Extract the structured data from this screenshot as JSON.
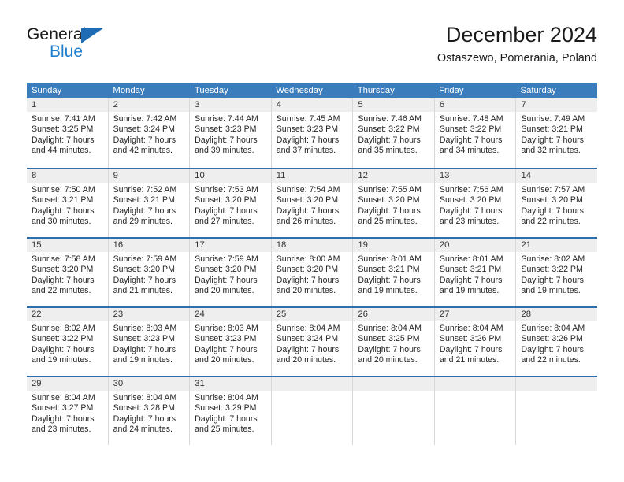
{
  "brand": {
    "name_top": "General",
    "name_bottom": "Blue",
    "triangle_color": "#1f6cb4",
    "bottom_color": "#1f7fd0"
  },
  "header": {
    "title": "December 2024",
    "subtitle": "Ostaszewo, Pomerania, Poland"
  },
  "colors": {
    "header_bar": "#3b7cbd",
    "week_divider": "#2f6fae",
    "day_band": "#eeeeee",
    "cell_border": "#d8d8d8"
  },
  "weekdays": [
    "Sunday",
    "Monday",
    "Tuesday",
    "Wednesday",
    "Thursday",
    "Friday",
    "Saturday"
  ],
  "weeks": [
    [
      {
        "day": "1",
        "sunrise": "Sunrise: 7:41 AM",
        "sunset": "Sunset: 3:25 PM",
        "daylight1": "Daylight: 7 hours",
        "daylight2": "and 44 minutes."
      },
      {
        "day": "2",
        "sunrise": "Sunrise: 7:42 AM",
        "sunset": "Sunset: 3:24 PM",
        "daylight1": "Daylight: 7 hours",
        "daylight2": "and 42 minutes."
      },
      {
        "day": "3",
        "sunrise": "Sunrise: 7:44 AM",
        "sunset": "Sunset: 3:23 PM",
        "daylight1": "Daylight: 7 hours",
        "daylight2": "and 39 minutes."
      },
      {
        "day": "4",
        "sunrise": "Sunrise: 7:45 AM",
        "sunset": "Sunset: 3:23 PM",
        "daylight1": "Daylight: 7 hours",
        "daylight2": "and 37 minutes."
      },
      {
        "day": "5",
        "sunrise": "Sunrise: 7:46 AM",
        "sunset": "Sunset: 3:22 PM",
        "daylight1": "Daylight: 7 hours",
        "daylight2": "and 35 minutes."
      },
      {
        "day": "6",
        "sunrise": "Sunrise: 7:48 AM",
        "sunset": "Sunset: 3:22 PM",
        "daylight1": "Daylight: 7 hours",
        "daylight2": "and 34 minutes."
      },
      {
        "day": "7",
        "sunrise": "Sunrise: 7:49 AM",
        "sunset": "Sunset: 3:21 PM",
        "daylight1": "Daylight: 7 hours",
        "daylight2": "and 32 minutes."
      }
    ],
    [
      {
        "day": "8",
        "sunrise": "Sunrise: 7:50 AM",
        "sunset": "Sunset: 3:21 PM",
        "daylight1": "Daylight: 7 hours",
        "daylight2": "and 30 minutes."
      },
      {
        "day": "9",
        "sunrise": "Sunrise: 7:52 AM",
        "sunset": "Sunset: 3:21 PM",
        "daylight1": "Daylight: 7 hours",
        "daylight2": "and 29 minutes."
      },
      {
        "day": "10",
        "sunrise": "Sunrise: 7:53 AM",
        "sunset": "Sunset: 3:20 PM",
        "daylight1": "Daylight: 7 hours",
        "daylight2": "and 27 minutes."
      },
      {
        "day": "11",
        "sunrise": "Sunrise: 7:54 AM",
        "sunset": "Sunset: 3:20 PM",
        "daylight1": "Daylight: 7 hours",
        "daylight2": "and 26 minutes."
      },
      {
        "day": "12",
        "sunrise": "Sunrise: 7:55 AM",
        "sunset": "Sunset: 3:20 PM",
        "daylight1": "Daylight: 7 hours",
        "daylight2": "and 25 minutes."
      },
      {
        "day": "13",
        "sunrise": "Sunrise: 7:56 AM",
        "sunset": "Sunset: 3:20 PM",
        "daylight1": "Daylight: 7 hours",
        "daylight2": "and 23 minutes."
      },
      {
        "day": "14",
        "sunrise": "Sunrise: 7:57 AM",
        "sunset": "Sunset: 3:20 PM",
        "daylight1": "Daylight: 7 hours",
        "daylight2": "and 22 minutes."
      }
    ],
    [
      {
        "day": "15",
        "sunrise": "Sunrise: 7:58 AM",
        "sunset": "Sunset: 3:20 PM",
        "daylight1": "Daylight: 7 hours",
        "daylight2": "and 22 minutes."
      },
      {
        "day": "16",
        "sunrise": "Sunrise: 7:59 AM",
        "sunset": "Sunset: 3:20 PM",
        "daylight1": "Daylight: 7 hours",
        "daylight2": "and 21 minutes."
      },
      {
        "day": "17",
        "sunrise": "Sunrise: 7:59 AM",
        "sunset": "Sunset: 3:20 PM",
        "daylight1": "Daylight: 7 hours",
        "daylight2": "and 20 minutes."
      },
      {
        "day": "18",
        "sunrise": "Sunrise: 8:00 AM",
        "sunset": "Sunset: 3:20 PM",
        "daylight1": "Daylight: 7 hours",
        "daylight2": "and 20 minutes."
      },
      {
        "day": "19",
        "sunrise": "Sunrise: 8:01 AM",
        "sunset": "Sunset: 3:21 PM",
        "daylight1": "Daylight: 7 hours",
        "daylight2": "and 19 minutes."
      },
      {
        "day": "20",
        "sunrise": "Sunrise: 8:01 AM",
        "sunset": "Sunset: 3:21 PM",
        "daylight1": "Daylight: 7 hours",
        "daylight2": "and 19 minutes."
      },
      {
        "day": "21",
        "sunrise": "Sunrise: 8:02 AM",
        "sunset": "Sunset: 3:22 PM",
        "daylight1": "Daylight: 7 hours",
        "daylight2": "and 19 minutes."
      }
    ],
    [
      {
        "day": "22",
        "sunrise": "Sunrise: 8:02 AM",
        "sunset": "Sunset: 3:22 PM",
        "daylight1": "Daylight: 7 hours",
        "daylight2": "and 19 minutes."
      },
      {
        "day": "23",
        "sunrise": "Sunrise: 8:03 AM",
        "sunset": "Sunset: 3:23 PM",
        "daylight1": "Daylight: 7 hours",
        "daylight2": "and 19 minutes."
      },
      {
        "day": "24",
        "sunrise": "Sunrise: 8:03 AM",
        "sunset": "Sunset: 3:23 PM",
        "daylight1": "Daylight: 7 hours",
        "daylight2": "and 20 minutes."
      },
      {
        "day": "25",
        "sunrise": "Sunrise: 8:04 AM",
        "sunset": "Sunset: 3:24 PM",
        "daylight1": "Daylight: 7 hours",
        "daylight2": "and 20 minutes."
      },
      {
        "day": "26",
        "sunrise": "Sunrise: 8:04 AM",
        "sunset": "Sunset: 3:25 PM",
        "daylight1": "Daylight: 7 hours",
        "daylight2": "and 20 minutes."
      },
      {
        "day": "27",
        "sunrise": "Sunrise: 8:04 AM",
        "sunset": "Sunset: 3:26 PM",
        "daylight1": "Daylight: 7 hours",
        "daylight2": "and 21 minutes."
      },
      {
        "day": "28",
        "sunrise": "Sunrise: 8:04 AM",
        "sunset": "Sunset: 3:26 PM",
        "daylight1": "Daylight: 7 hours",
        "daylight2": "and 22 minutes."
      }
    ],
    [
      {
        "day": "29",
        "sunrise": "Sunrise: 8:04 AM",
        "sunset": "Sunset: 3:27 PM",
        "daylight1": "Daylight: 7 hours",
        "daylight2": "and 23 minutes."
      },
      {
        "day": "30",
        "sunrise": "Sunrise: 8:04 AM",
        "sunset": "Sunset: 3:28 PM",
        "daylight1": "Daylight: 7 hours",
        "daylight2": "and 24 minutes."
      },
      {
        "day": "31",
        "sunrise": "Sunrise: 8:04 AM",
        "sunset": "Sunset: 3:29 PM",
        "daylight1": "Daylight: 7 hours",
        "daylight2": "and 25 minutes."
      },
      {
        "day": "",
        "sunrise": "",
        "sunset": "",
        "daylight1": "",
        "daylight2": ""
      },
      {
        "day": "",
        "sunrise": "",
        "sunset": "",
        "daylight1": "",
        "daylight2": ""
      },
      {
        "day": "",
        "sunrise": "",
        "sunset": "",
        "daylight1": "",
        "daylight2": ""
      },
      {
        "day": "",
        "sunrise": "",
        "sunset": "",
        "daylight1": "",
        "daylight2": ""
      }
    ]
  ]
}
